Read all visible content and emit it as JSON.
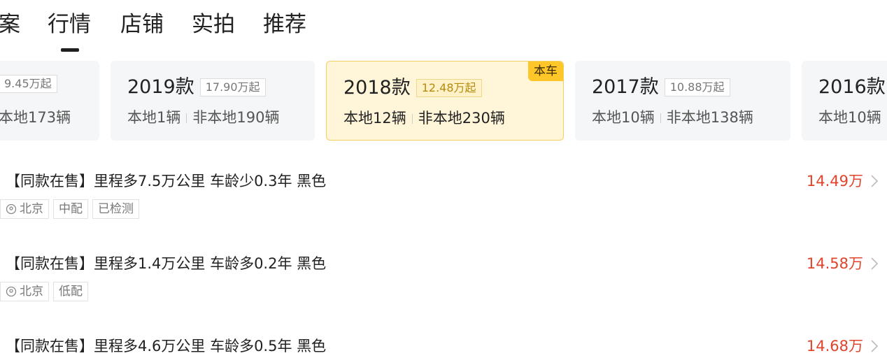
{
  "tabs": [
    {
      "label": "案"
    },
    {
      "label": "行情"
    },
    {
      "label": "店铺"
    },
    {
      "label": "实拍"
    },
    {
      "label": "推荐"
    }
  ],
  "active_tab": "行情",
  "years": [
    {
      "title": "",
      "price": "9.45万起",
      "local": "本地173辆",
      "nonlocal": ""
    },
    {
      "title": "2019款",
      "price": "17.90万起",
      "local": "本地1辆",
      "nonlocal": "非本地190辆"
    },
    {
      "title": "2018款",
      "price": "12.48万起",
      "local": "本地12辆",
      "nonlocal": "非本地230辆",
      "badge": "本车"
    },
    {
      "title": "2017款",
      "price": "10.88万起",
      "local": "本地10辆",
      "nonlocal": "非本地138辆"
    },
    {
      "title": "2016款",
      "price": "",
      "local": "本地10辆",
      "nonlocal": ""
    }
  ],
  "listings": [
    {
      "title": "【同款在售】里程多7.5万公里 车龄少0.3年 黑色",
      "price": "14.49万",
      "tags": [
        "北京",
        "中配",
        "已检测"
      ]
    },
    {
      "title": "【同款在售】里程多1.4万公里 车龄多0.2年 黑色",
      "price": "14.58万",
      "tags": [
        "北京",
        "低配"
      ]
    },
    {
      "title": "【同款在售】里程多4.6万公里 车龄多0.5年 黑色",
      "price": "14.68万",
      "tags": []
    }
  ],
  "colors": {
    "accent_yellow": "#ffc629",
    "price_red": "#e0442a",
    "active_bg": "#fff6d9"
  },
  "icons": {
    "location": "location-pin-icon",
    "chevron": "chevron-right-icon"
  }
}
